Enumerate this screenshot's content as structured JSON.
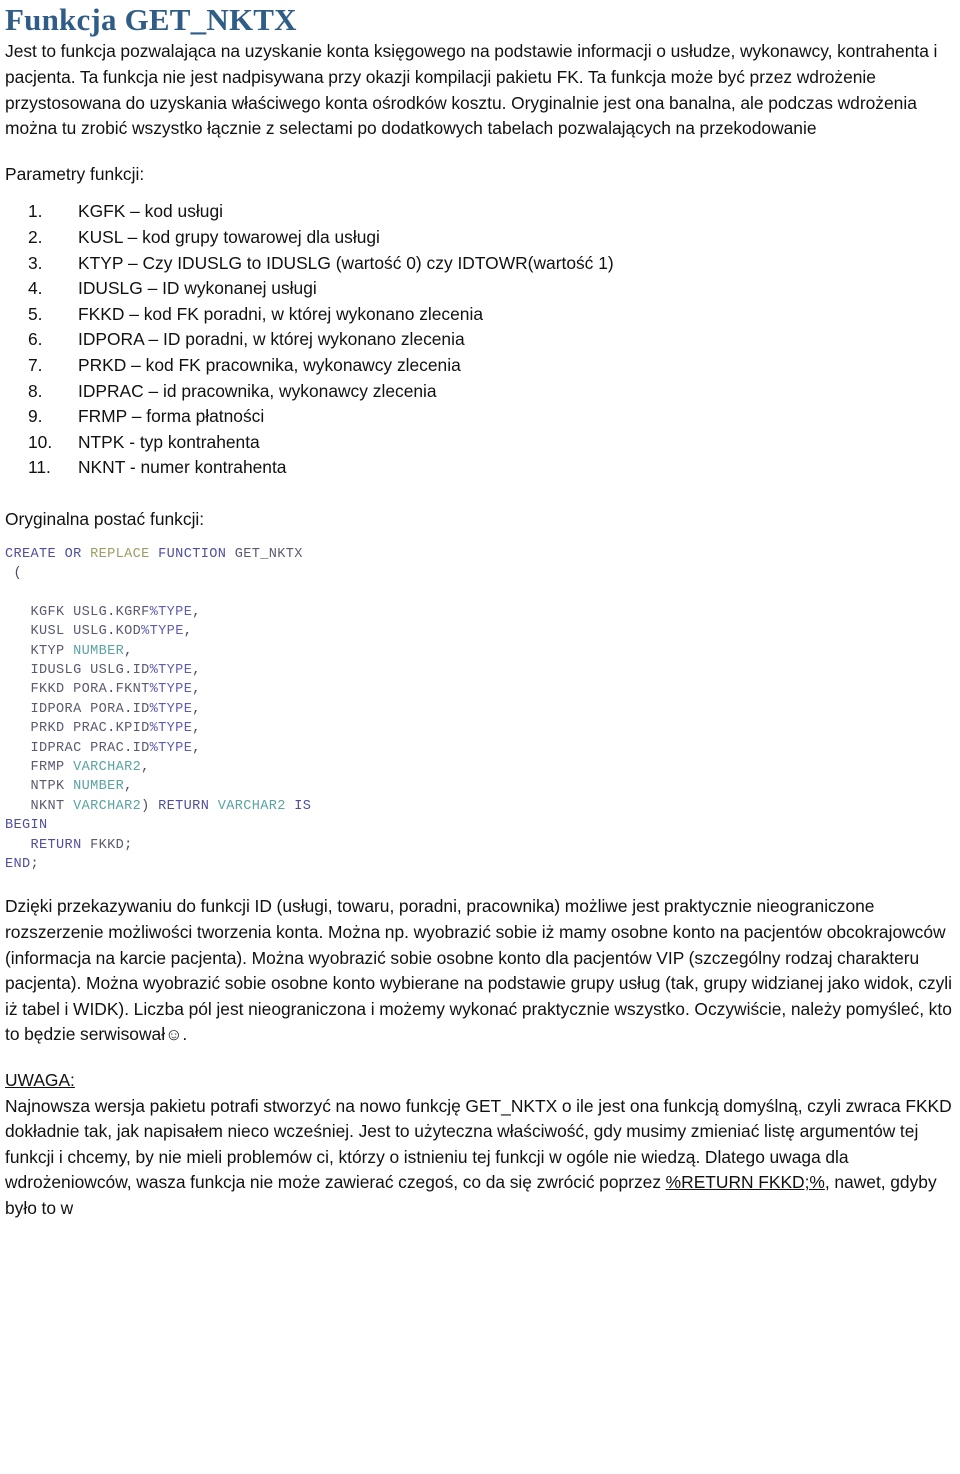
{
  "document": {
    "title": "Funkcja GET_NKTX",
    "title_color": "#2F5D87",
    "intro_paragraph": "Jest to funkcja pozwalająca na uzyskanie konta księgowego na podstawie informacji o usłudze, wykonawcy, kontrahenta i pacjenta. Ta funkcja nie jest nadpisywana przy okazji kompilacji pakietu FK. Ta funkcja może być przez wdrożenie przystosowana do uzyskania właściwego konta ośrodków kosztu. Oryginalnie jest ona banalna, ale podczas wdrożenia można tu zrobić wszystko łącznie z selectami po dodatkowych tabelach pozwalających na przekodowanie",
    "params_heading": "Parametry funkcji:",
    "params": [
      {
        "num": "1.",
        "text": "KGFK – kod usługi"
      },
      {
        "num": "2.",
        "text": "KUSL – kod grupy towarowej dla usługi"
      },
      {
        "num": "3.",
        "text": "KTYP – Czy  IDUSLG to IDUSLG (wartość 0) czy IDTOWR(wartość 1)"
      },
      {
        "num": "4.",
        "text": "IDUSLG – ID wykonanej usługi"
      },
      {
        "num": "5.",
        "text": "FKKD – kod FK poradni, w której wykonano zlecenia"
      },
      {
        "num": "6.",
        "text": "IDPORA – ID poradni, w której wykonano zlecenia"
      },
      {
        "num": "7.",
        "text": "PRKD – kod FK pracownika, wykonawcy zlecenia"
      },
      {
        "num": "8.",
        "text": "IDPRAC – id pracownika, wykonawcy zlecenia"
      },
      {
        "num": "9.",
        "text": "FRMP – forma płatności"
      },
      {
        "num": "10.",
        "text": "NTPK  - typ kontrahenta"
      },
      {
        "num": "11.",
        "text": "NKNT  - numer kontrahenta"
      }
    ],
    "code_heading": "Oryginalna postać funkcji:",
    "code": {
      "language": "plsql",
      "lines": [
        "CREATE OR REPLACE FUNCTION GET_NKTX",
        " (",
        "",
        "   KGFK USLG.KGRF%TYPE,",
        "   KUSL USLG.KOD%TYPE,",
        "   KTYP NUMBER,",
        "   IDUSLG USLG.ID%TYPE,",
        "   FKKD PORA.FKNT%TYPE,",
        "   IDPORA PORA.ID%TYPE,",
        "   PRKD PRAC.KPID%TYPE,",
        "   IDPRAC PRAC.ID%TYPE,",
        "   FRMP VARCHAR2,",
        "   NTPK NUMBER,",
        "   NKNT VARCHAR2) RETURN VARCHAR2 IS",
        "BEGIN",
        "   RETURN FKKD;",
        "END;"
      ],
      "colors": {
        "keyword": "#4f4f9e",
        "replace_keyword": "#9c9c63",
        "type_attr": "#5c5cb5",
        "datatype": "#5aa3a3",
        "identifier": "#5a5a70"
      }
    },
    "body_paragraph": "Dzięki przekazywaniu do funkcji ID (usługi, towaru, poradni, pracownika) możliwe jest praktycznie nieograniczone rozszerzenie możliwości tworzenia konta. Można np. wyobrazić sobie iż mamy osobne konto na pacjentów obcokrajowców (informacja na karcie pacjenta). Można wyobrazić sobie osobne konto dla pacjentów VIP (szczególny rodzaj charakteru pacjenta). Można wyobrazić sobie osobne konto wybierane na podstawie grupy usług (tak, grupy widzianej jako widok, czyli iż tabel i WIDK). Liczba pól jest nieograniczona i możemy wykonać praktycznie wszystko. Oczywiście, należy pomyśleć, kto to będzie serwisował",
    "body_paragraph_smiley": "☺",
    "body_paragraph_end": ".",
    "warning_heading": "UWAGA:",
    "warning_part1": "Najnowsza wersja pakietu potrafi stworzyć na nowo funkcję GET_NKTX o ile jest ona funkcją domyślną, czyli zwraca FKKD dokładnie tak, jak napisałem nieco wcześniej. Jest to użyteczna właściwość, gdy musimy zmieniać listę argumentów tej funkcji i chcemy, by nie mieli problemów ci, którzy o istnieniu tej funkcji w ogóle nie wiedzą. Dlatego uwaga dla wdrożeniowców, wasza funkcja nie może zawierać czegoś, co da się zwrócić poprzez ",
    "warning_underlined": "%RETURN FKKD;%",
    "warning_part2": ", nawet, gdyby było to w"
  }
}
